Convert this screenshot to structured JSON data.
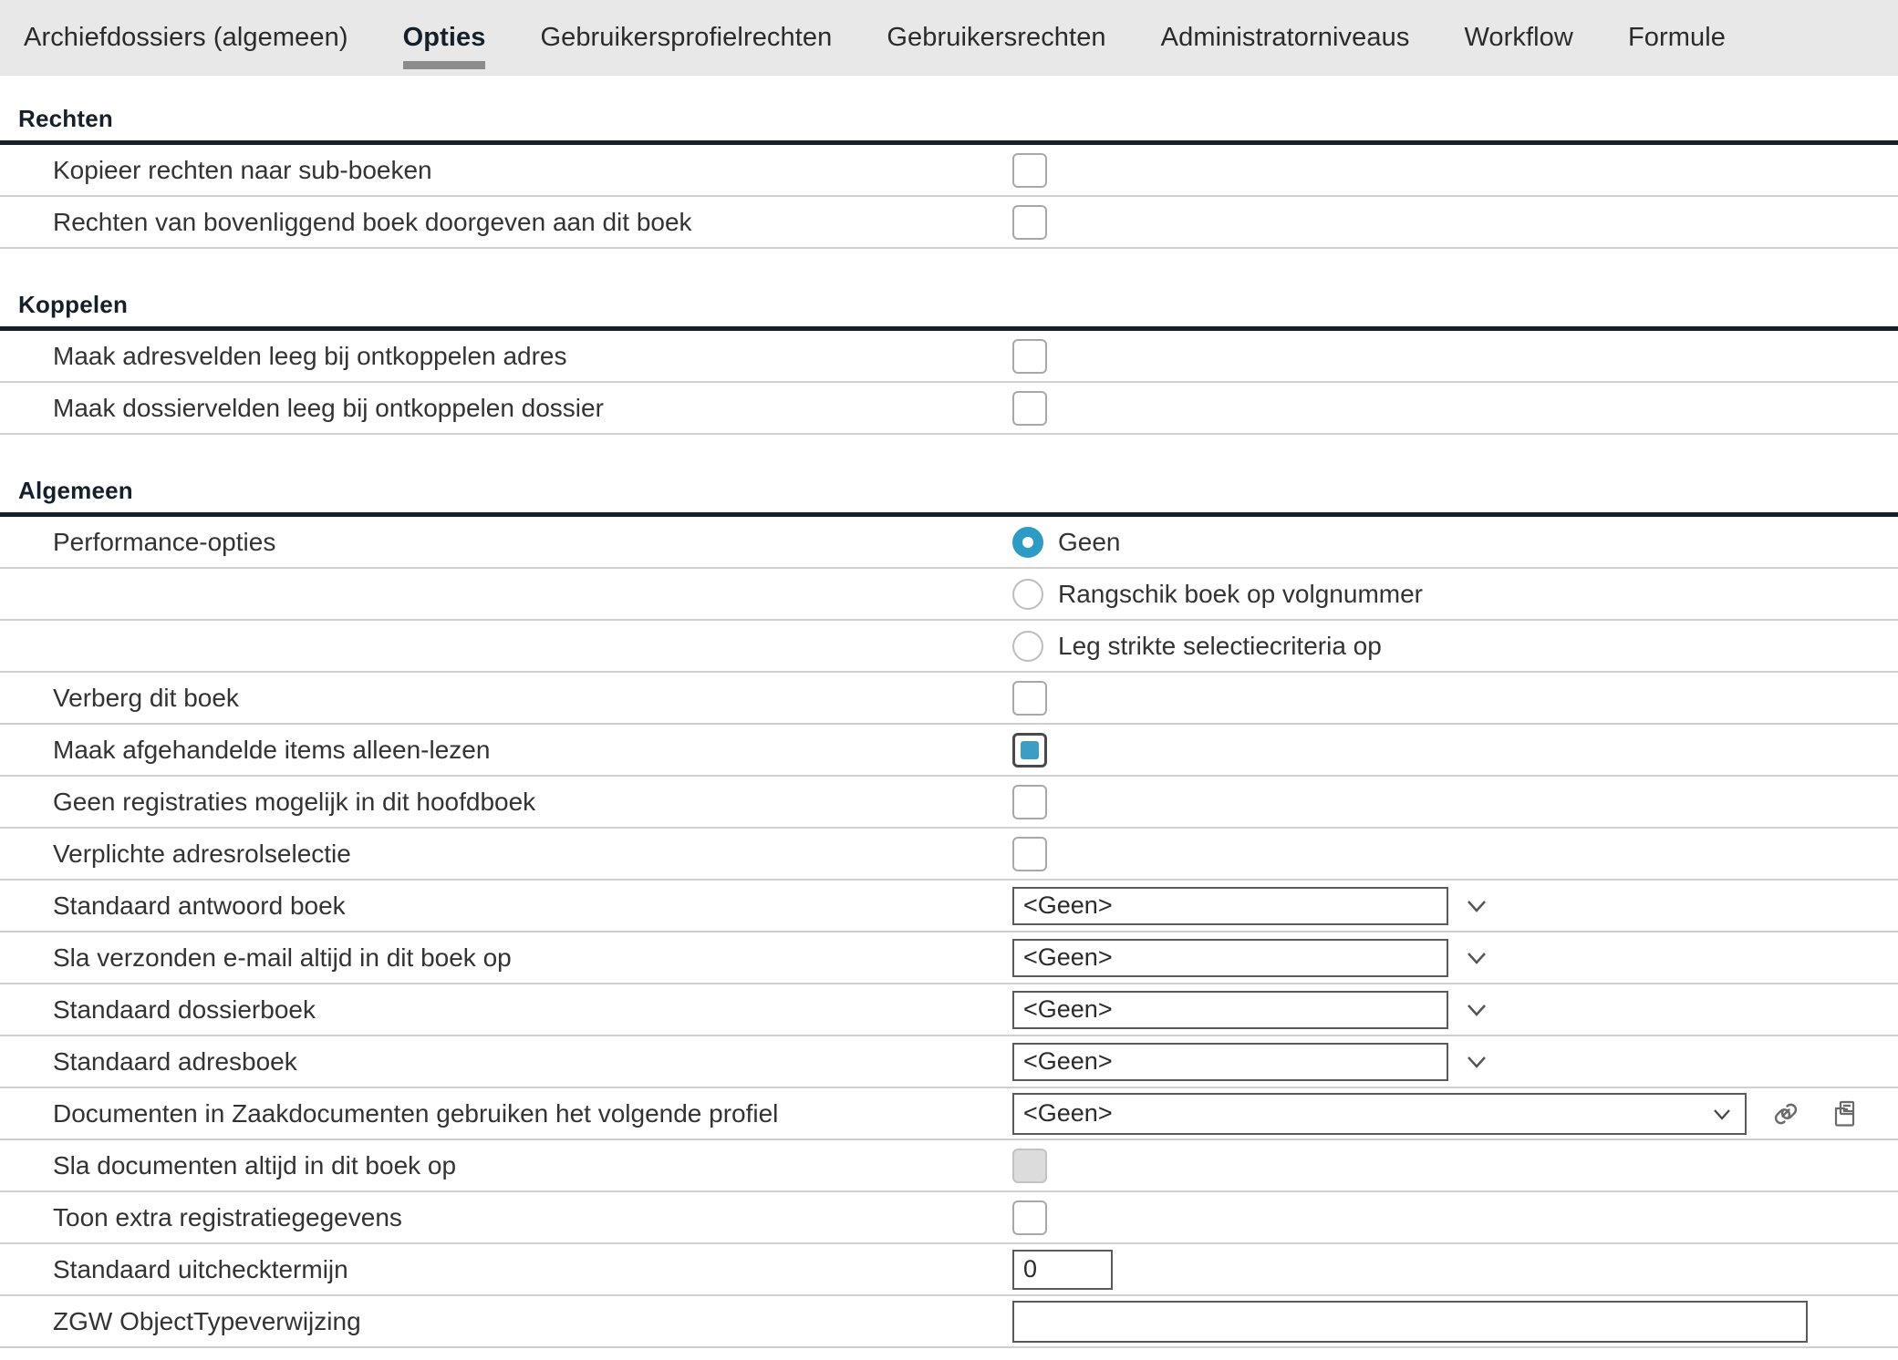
{
  "tabs": [
    {
      "label": "Archiefdossiers (algemeen)",
      "active": false
    },
    {
      "label": "Opties",
      "active": true
    },
    {
      "label": "Gebruikersprofielrechten",
      "active": false
    },
    {
      "label": "Gebruikersrechten",
      "active": false
    },
    {
      "label": "Administratorniveaus",
      "active": false
    },
    {
      "label": "Workflow",
      "active": false
    },
    {
      "label": "Formule",
      "active": false
    }
  ],
  "sections": {
    "rechten": {
      "header": "Rechten",
      "rows": [
        {
          "label": "Kopieer rechten naar sub-boeken",
          "checked": false
        },
        {
          "label": "Rechten van bovenliggend boek doorgeven aan dit boek",
          "checked": false
        }
      ]
    },
    "koppelen": {
      "header": "Koppelen",
      "rows": [
        {
          "label": "Maak adresvelden leeg bij ontkoppelen adres",
          "checked": false
        },
        {
          "label": "Maak dossiervelden leeg bij ontkoppelen dossier",
          "checked": false
        }
      ]
    },
    "algemeen": {
      "header": "Algemeen",
      "performance": {
        "label": "Performance-opties",
        "options": [
          {
            "label": "Geen",
            "selected": true
          },
          {
            "label": "Rangschik boek op volgnummer",
            "selected": false
          },
          {
            "label": "Leg strikte selectiecriteria op",
            "selected": false
          }
        ]
      },
      "checkboxes": [
        {
          "label": "Verberg dit boek",
          "checked": false,
          "disabled": false
        },
        {
          "label": "Maak afgehandelde items alleen-lezen",
          "checked": true,
          "disabled": false
        },
        {
          "label": "Geen registraties mogelijk in dit hoofdboek",
          "checked": false,
          "disabled": false
        },
        {
          "label": "Verplichte adresrolselectie",
          "checked": false,
          "disabled": false
        }
      ],
      "dropdowns": [
        {
          "label": "Standaard antwoord boek",
          "value": "<Geen>"
        },
        {
          "label": "Sla verzonden e-mail altijd in dit boek op",
          "value": "<Geen>"
        },
        {
          "label": "Standaard dossierboek",
          "value": "<Geen>"
        },
        {
          "label": "Standaard adresboek",
          "value": "<Geen>"
        }
      ],
      "profile_row": {
        "label": "Documenten in Zaakdocumenten gebruiken het volgende profiel",
        "value": "<Geen>",
        "link_icon": "link-icon",
        "folder_icon": "folder-document-icon"
      },
      "trailing_checkboxes": [
        {
          "label": "Sla documenten altijd in dit boek op",
          "checked": false,
          "disabled": true
        },
        {
          "label": "Toon extra registratiegegevens",
          "checked": false,
          "disabled": false
        }
      ],
      "checkout_term": {
        "label": "Standaard uitchecktermijn",
        "value": "0"
      },
      "zgw": {
        "label": "ZGW ObjectTypeverwijzing",
        "value": ""
      }
    }
  },
  "colors": {
    "accent": "#3d9ec4",
    "radio_accent": "#2e9bc4",
    "section_rule": "#15202b",
    "tabbar_bg": "#e8e8e8",
    "tab_underline": "#8c8c8c",
    "row_rule": "#cfcfcf"
  }
}
